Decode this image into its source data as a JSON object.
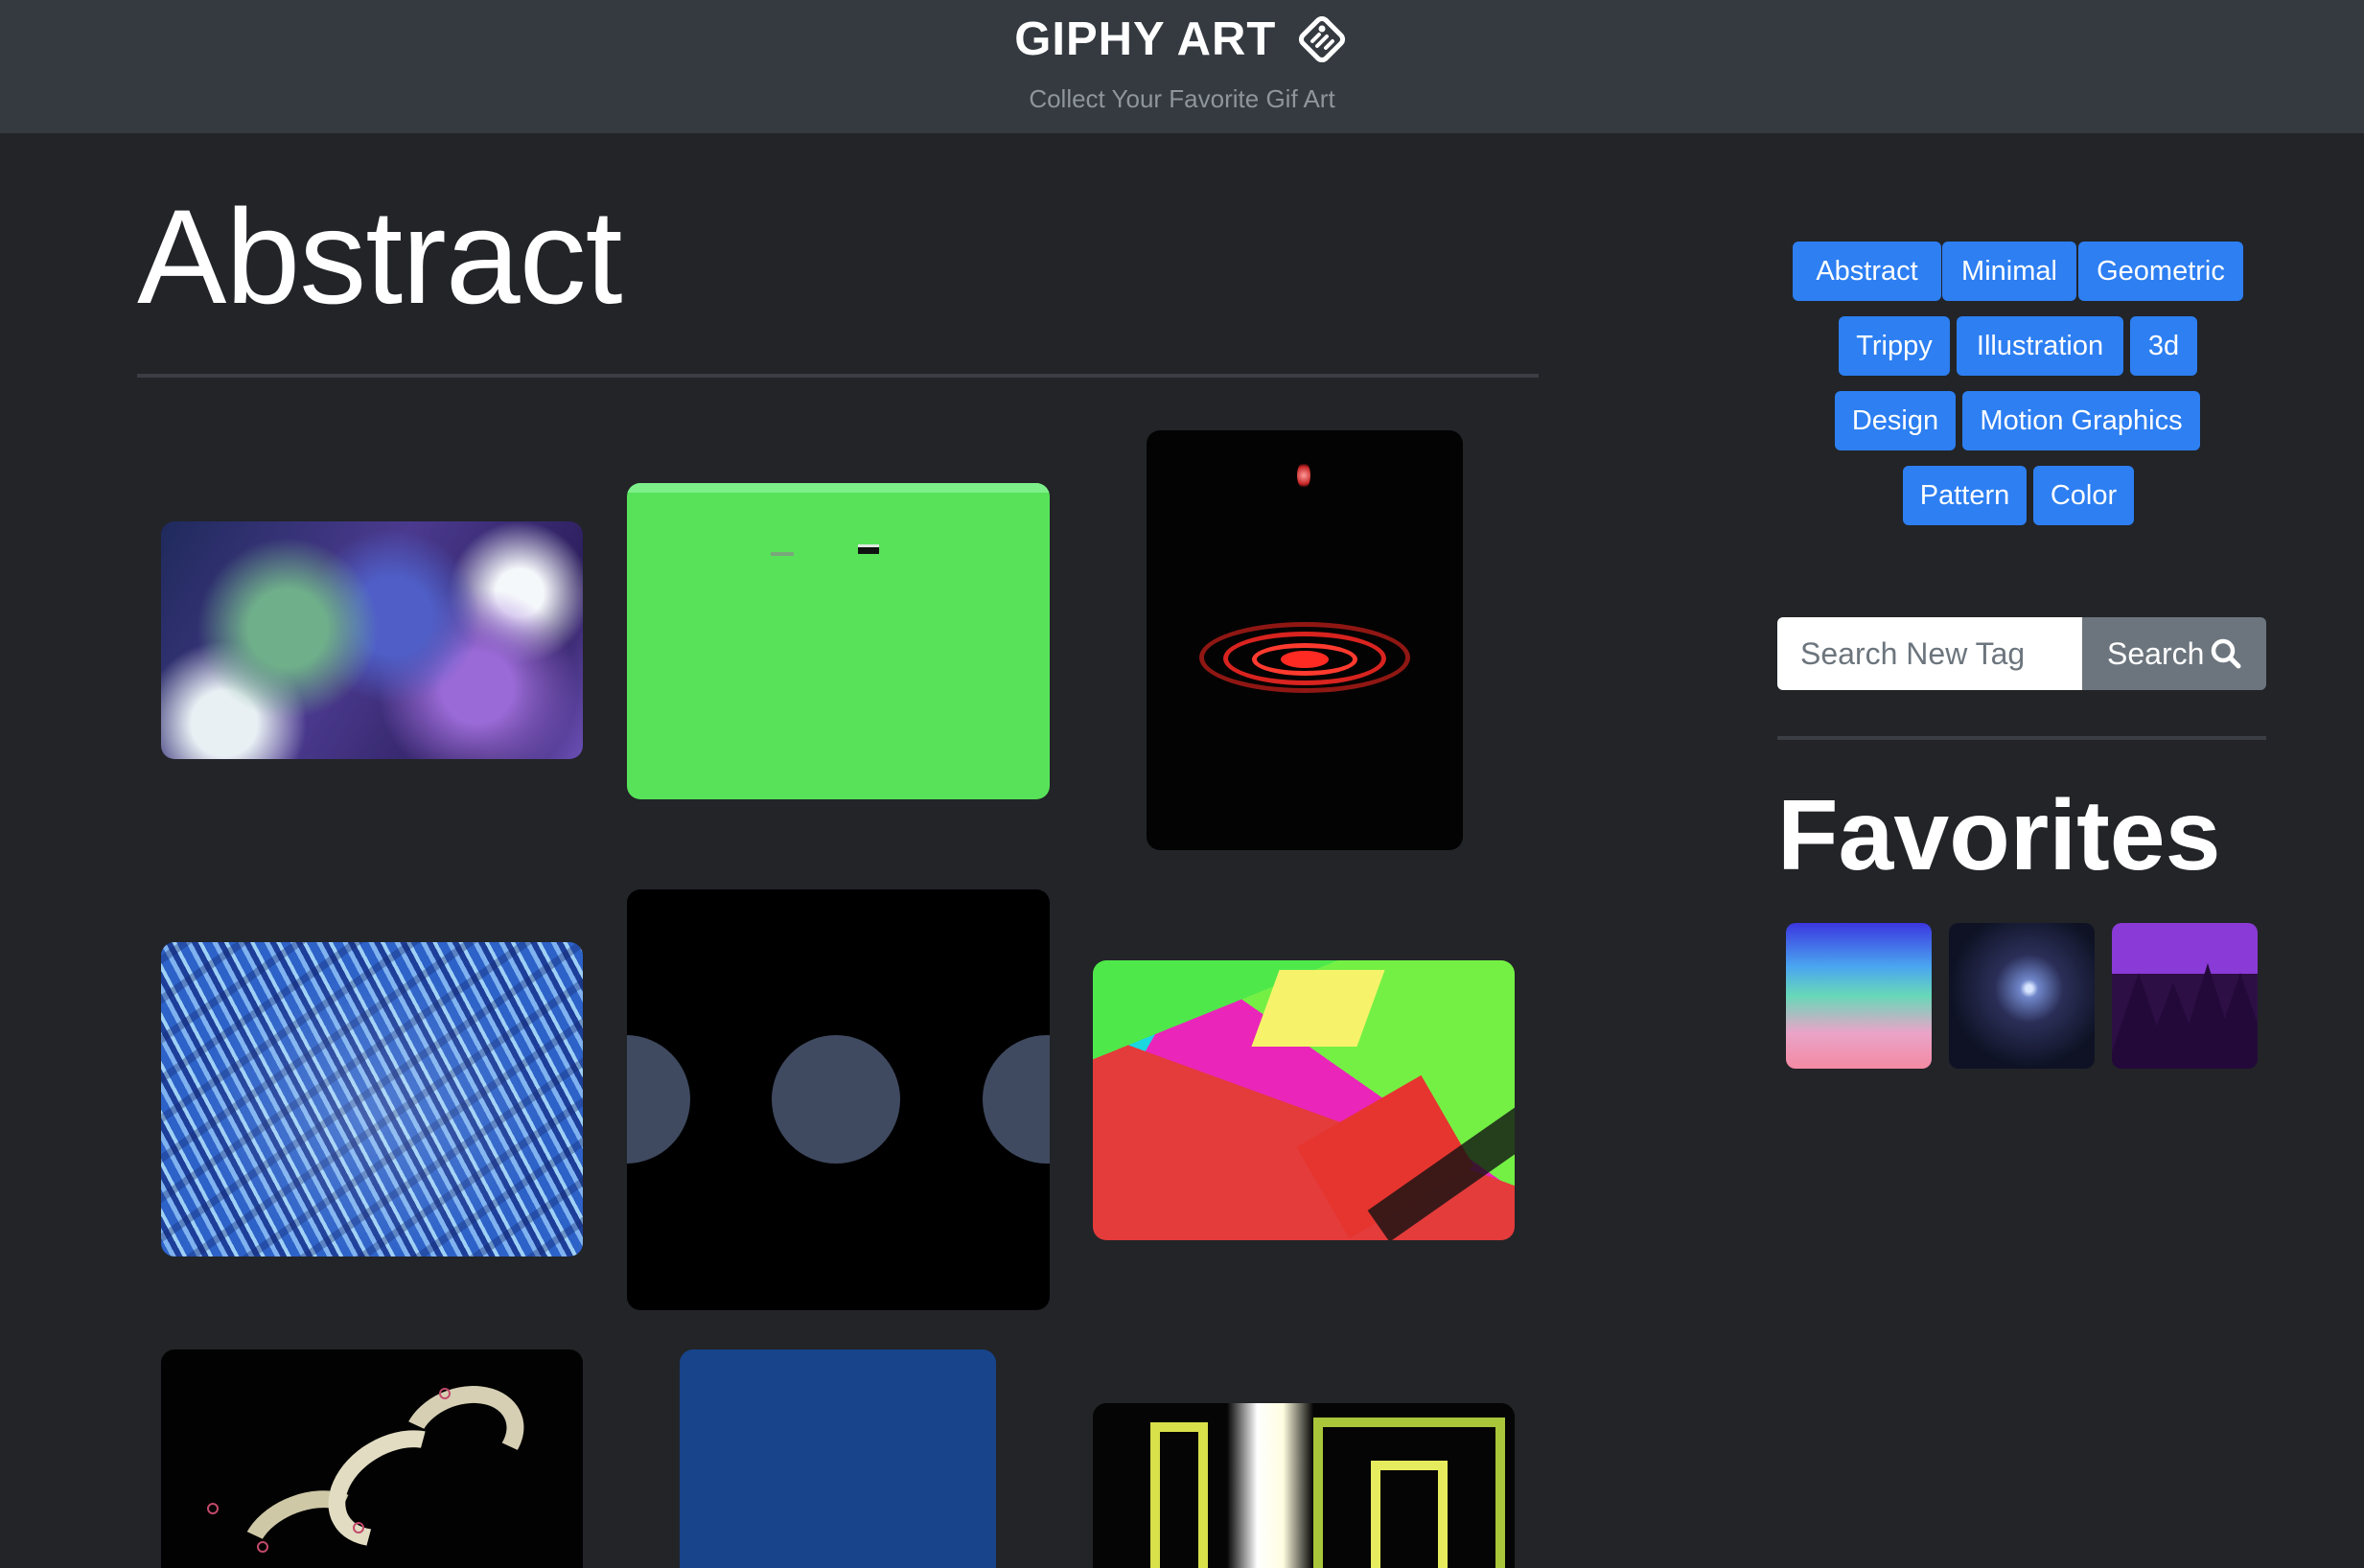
{
  "header": {
    "brand": "GIPHY ART",
    "subtitle": "Collect Your Favorite Gif Art"
  },
  "main": {
    "title": "Abstract",
    "gifs": [
      {
        "name": "gif-abstract-1"
      },
      {
        "name": "gif-abstract-2"
      },
      {
        "name": "gif-abstract-3"
      },
      {
        "name": "gif-abstract-4"
      },
      {
        "name": "gif-abstract-5"
      },
      {
        "name": "gif-abstract-6"
      },
      {
        "name": "gif-abstract-7"
      },
      {
        "name": "gif-abstract-8"
      },
      {
        "name": "gif-abstract-9"
      }
    ]
  },
  "sidebar": {
    "tags": [
      "Abstract",
      "Minimal",
      "Geometric",
      "Trippy",
      "Illustration",
      "3d",
      "Design",
      "Motion Graphics",
      "Pattern",
      "Color"
    ],
    "search": {
      "placeholder": "Search New Tag",
      "value": "",
      "button_label": "Search",
      "icon": "search-icon"
    },
    "favorites_title": "Favorites"
  },
  "colors": {
    "background": "#222428",
    "header": "#353a40",
    "tag_button": "#2d7ff2",
    "search_button": "#6c757d"
  }
}
